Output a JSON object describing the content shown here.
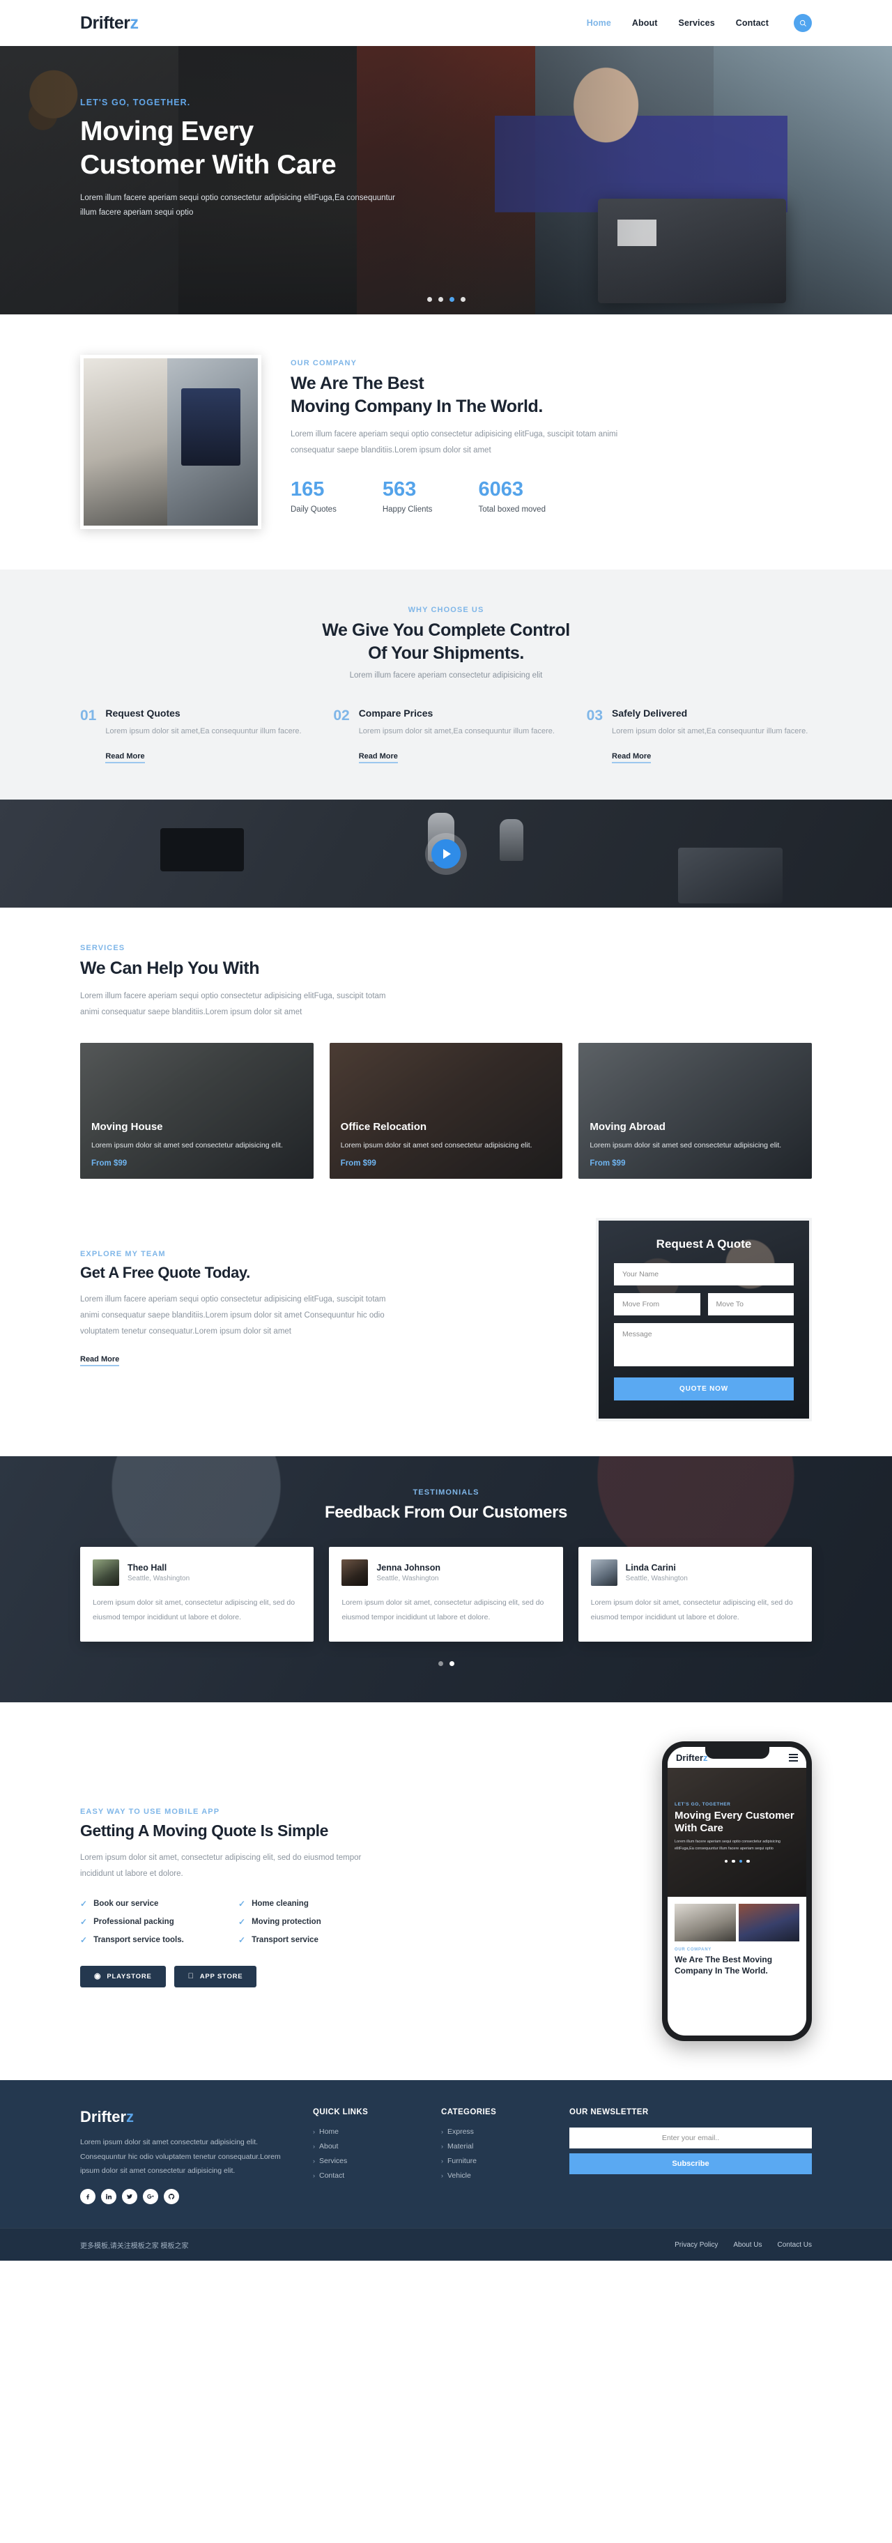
{
  "brand": {
    "name_main": "Drifter",
    "name_accent": "z"
  },
  "nav": {
    "items": [
      {
        "label": "Home",
        "active": true
      },
      {
        "label": "About",
        "active": false
      },
      {
        "label": "Services",
        "active": false
      },
      {
        "label": "Contact",
        "active": false
      }
    ],
    "search_icon": "search-icon"
  },
  "hero": {
    "kicker": "LET'S GO, TOGETHER.",
    "title_line1": "Moving Every",
    "title_line2": "Customer With Care",
    "subtitle": "Lorem illum facere aperiam sequi optio consectetur adipisicing elitFuga,Ea consequuntur illum facere aperiam sequi optio",
    "slide_count": 4,
    "active_slide": 3
  },
  "about": {
    "kicker": "OUR COMPANY",
    "title_line1": "We Are The Best",
    "title_line2": "Moving Company In The World.",
    "description": "Lorem illum facere aperiam sequi optio consectetur adipisicing elitFuga, suscipit totam animi consequatur saepe blanditiis.Lorem ipsum dolor sit amet",
    "stats": [
      {
        "value": "165",
        "label": "Daily Quotes"
      },
      {
        "value": "563",
        "label": "Happy Clients"
      },
      {
        "value": "6063",
        "label": "Total boxed moved"
      }
    ]
  },
  "why": {
    "kicker": "WHY CHOOSE US",
    "title_line1": "We Give You Complete Control",
    "title_line2": "Of Your Shipments.",
    "subtitle": "Lorem illum facere aperiam consectetur adipisicing elit",
    "steps": [
      {
        "num": "01",
        "title": "Request Quotes",
        "text": "Lorem ipsum dolor sit amet,Ea consequuntur illum facere.",
        "link": "Read More"
      },
      {
        "num": "02",
        "title": "Compare Prices",
        "text": "Lorem ipsum dolor sit amet,Ea consequuntur illum facere.",
        "link": "Read More"
      },
      {
        "num": "03",
        "title": "Safely Delivered",
        "text": "Lorem ipsum dolor sit amet,Ea consequuntur illum facere.",
        "link": "Read More"
      }
    ]
  },
  "video": {
    "play_icon": "play-icon"
  },
  "services": {
    "kicker": "SERVICES",
    "title": "We Can Help You With",
    "description": "Lorem illum facere aperiam sequi optio consectetur adipisicing elitFuga, suscipit totam animi consequatur saepe blanditiis.Lorem ipsum dolor sit amet",
    "cards": [
      {
        "title": "Moving House",
        "text": "Lorem ipsum dolor sit amet sed consectetur adipisicing elit.",
        "price": "From $99"
      },
      {
        "title": "Office Relocation",
        "text": "Lorem ipsum dolor sit amet sed consectetur adipisicing elit.",
        "price": "From $99"
      },
      {
        "title": "Moving Abroad",
        "text": "Lorem ipsum dolor sit amet sed consectetur adipisicing elit.",
        "price": "From $99"
      }
    ]
  },
  "quote": {
    "kicker": "EXPLORE MY TEAM",
    "title": "Get A Free Quote Today.",
    "description": "Lorem illum facere aperiam sequi optio consectetur adipisicing elitFuga, suscipit totam animi consequatur saepe blanditiis.Lorem ipsum dolor sit amet Consequuntur hic odio voluptatem tenetur consequatur.Lorem ipsum dolor sit amet",
    "read_more": "Read More",
    "form": {
      "title": "Request A Quote",
      "name_placeholder": "Your Name",
      "from_placeholder": "Move From",
      "to_placeholder": "Move To",
      "message_placeholder": "Message",
      "submit_label": "QUOTE NOW"
    }
  },
  "testimonials": {
    "kicker": "TESTIMONIALS",
    "title": "Feedback From Our Customers",
    "cards": [
      {
        "name": "Theo Hall",
        "location": "Seattle, Washington",
        "text": "Lorem ipsum dolor sit amet, consectetur adipiscing elit, sed do eiusmod tempor incididunt ut labore et dolore."
      },
      {
        "name": "Jenna Johnson",
        "location": "Seattle, Washington",
        "text": "Lorem ipsum dolor sit amet, consectetur adipiscing elit, sed do eiusmod tempor incididunt ut labore et dolore."
      },
      {
        "name": "Linda Carini",
        "location": "Seattle, Washington",
        "text": "Lorem ipsum dolor sit amet, consectetur adipiscing elit, sed do eiusmod tempor incididunt ut labore et dolore."
      }
    ],
    "dot_count": 2,
    "active_dot": 1
  },
  "app": {
    "kicker": "EASY WAY TO USE MOBILE APP",
    "title": "Getting A Moving Quote Is Simple",
    "description": "Lorem ipsum dolor sit amet, consectetur adipiscing elit, sed do eiusmod tempor incididunt ut labore et dolore.",
    "features": [
      "Book our service",
      "Home cleaning",
      "Professional packing",
      "Moving protection",
      "Transport service tools.",
      "Transport service"
    ],
    "buttons": [
      {
        "label": "PLAYSTORE",
        "icon": "playstore-icon"
      },
      {
        "label": "APP STORE",
        "icon": "apple-icon"
      }
    ],
    "phone": {
      "kicker": "LET'S GO, TOGETHER",
      "title": "Moving Every Customer With Care",
      "subtitle": "Lorem illum facere aperiam sequi optio consectetur adipisicing elitFuga,Ea consequuntur illum facere aperiam sequi optio",
      "about_kicker": "OUR COMPANY",
      "about_title": "We Are The Best Moving Company In The World.",
      "menu_icon": "hamburger-icon"
    }
  },
  "footer": {
    "description": "Lorem ipsum dolor sit amet consectetur adipisicing elit. Consequuntur hic odio voluptatem tenetur consequatur.Lorem ipsum dolor sit amet consectetur adipisicing elit.",
    "socials": [
      "facebook-icon",
      "linkedin-icon",
      "twitter-icon",
      "googleplus-icon",
      "github-icon"
    ],
    "quick_links": {
      "heading": "QUICK LINKS",
      "items": [
        "Home",
        "About",
        "Services",
        "Contact"
      ]
    },
    "categories": {
      "heading": "CATEGORIES",
      "items": [
        "Express",
        "Material",
        "Furniture",
        "Vehicle"
      ]
    },
    "newsletter": {
      "heading": "OUR NEWSLETTER",
      "placeholder": "Enter your email..",
      "button": "Subscribe"
    },
    "copyright": "更多模板,请关注模板之家 模板之家",
    "bottom_links": [
      "Privacy Policy",
      "About Us",
      "Contact Us"
    ]
  }
}
